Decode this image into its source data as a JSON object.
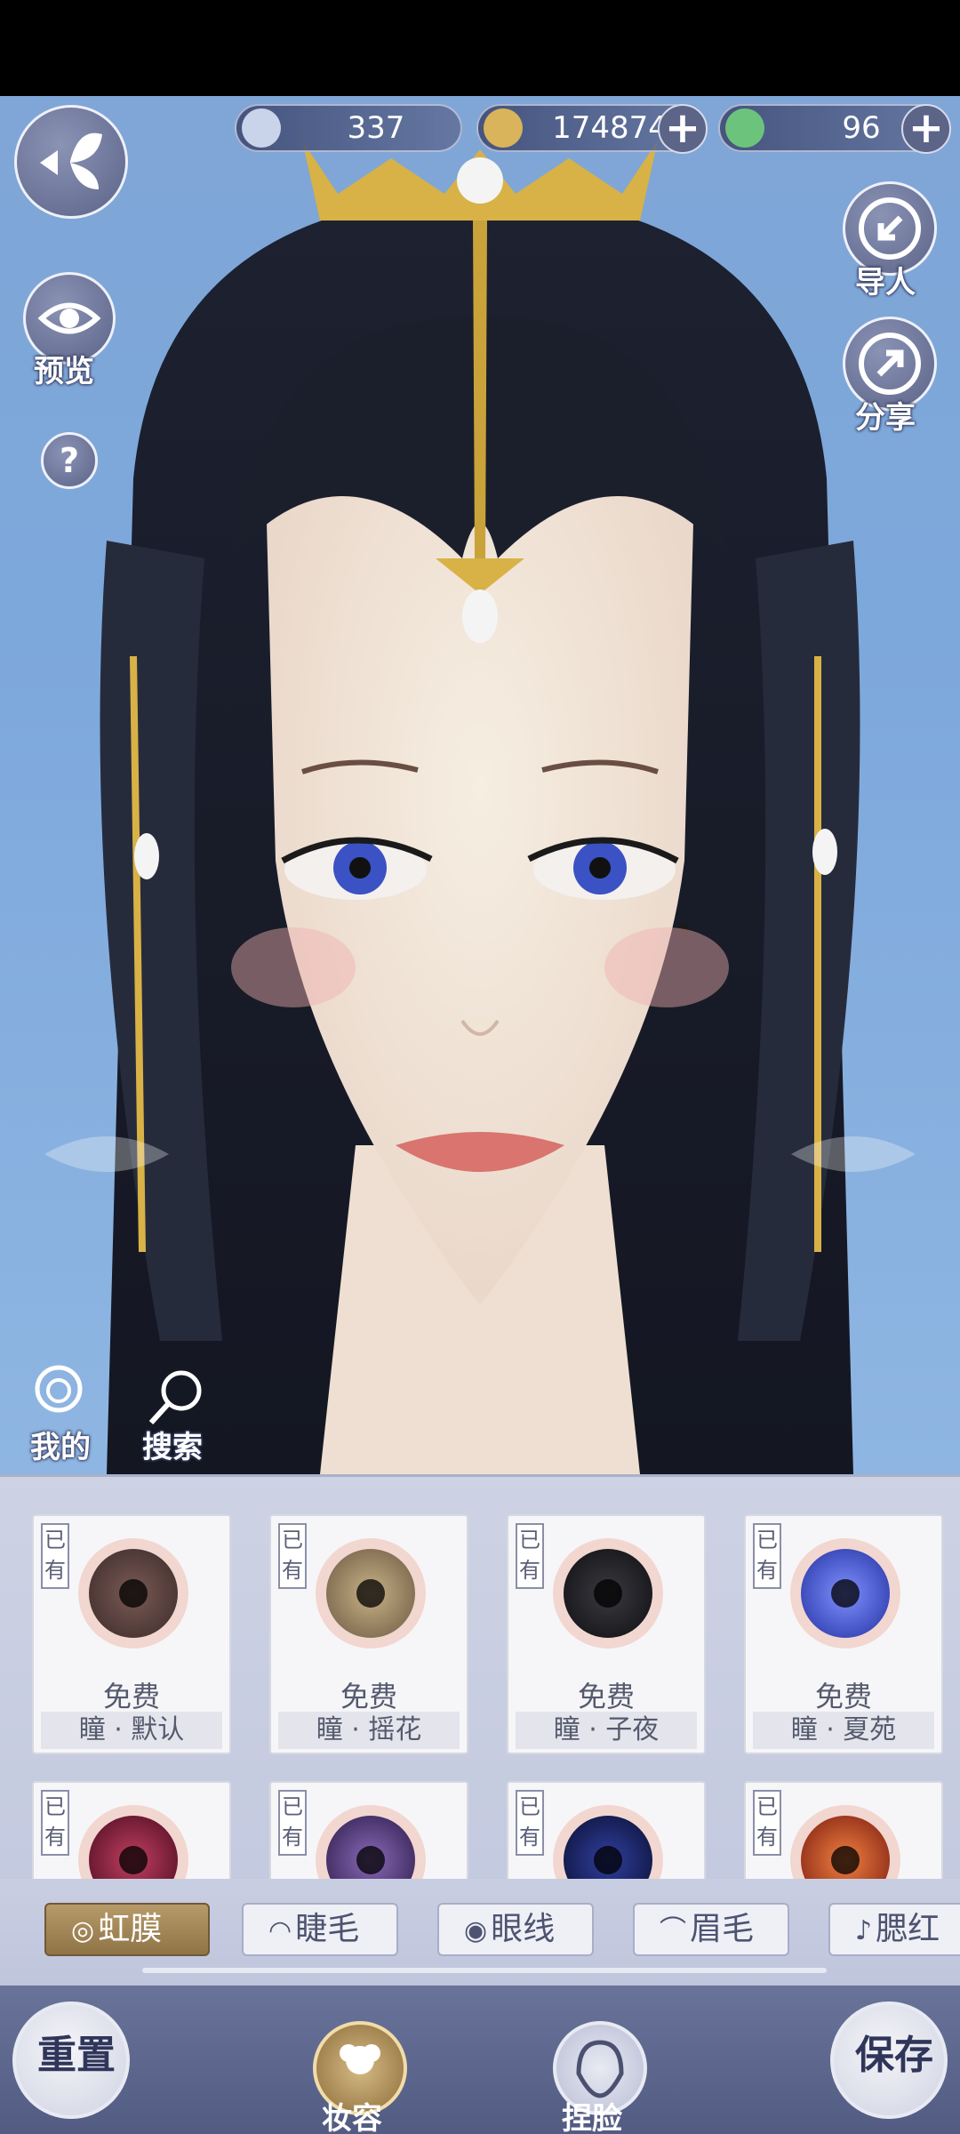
{
  "currencies": [
    {
      "name": "silver-coin",
      "value": "337",
      "color": "#c9d4ea"
    },
    {
      "name": "copper-coin",
      "value": "174874",
      "color": "#d9b45a"
    },
    {
      "name": "jade-token",
      "value": "96",
      "color": "#6cc47c"
    }
  ],
  "left_buttons": {
    "back_icon": "butterfly-back-icon",
    "preview_label": "预览",
    "help_symbol": "?"
  },
  "right_buttons": {
    "import_label": "导人",
    "share_label": "分享"
  },
  "scene_labels": {
    "mine_label": "我的",
    "search_label": "搜索"
  },
  "items": [
    {
      "owned": "已有",
      "price": "免费",
      "name": "瞳 · 默认",
      "iris_color": "#4a3a38"
    },
    {
      "owned": "已有",
      "price": "免费",
      "name": "瞳 · 摇花",
      "iris_color": "#8b7a5a"
    },
    {
      "owned": "已有",
      "price": "免费",
      "name": "瞳 · 子夜",
      "iris_color": "#1e1e22"
    },
    {
      "owned": "已有",
      "price": "免费",
      "name": "瞳 · 夏苑",
      "iris_color": "#3a48c8"
    },
    {
      "owned": "已有",
      "price": "",
      "name": "",
      "iris_color": "#6a1430"
    },
    {
      "owned": "已有",
      "price": "",
      "name": "",
      "iris_color": "#4a3070"
    },
    {
      "owned": "已有",
      "price": "",
      "name": "",
      "iris_color": "#141a4a"
    },
    {
      "owned": "已有",
      "price": "",
      "name": "",
      "iris_color": "#b84422"
    }
  ],
  "tabs": [
    {
      "label": "虹膜",
      "active": true
    },
    {
      "label": "睫毛",
      "active": false
    },
    {
      "label": "眼线",
      "active": false
    },
    {
      "label": "眉毛",
      "active": false
    },
    {
      "label": "腮红",
      "active": false
    }
  ],
  "bottom_bar": {
    "reset_label": "重置",
    "makeup_label": "妆容",
    "face_label": "捏脸",
    "save_label": "保存"
  }
}
